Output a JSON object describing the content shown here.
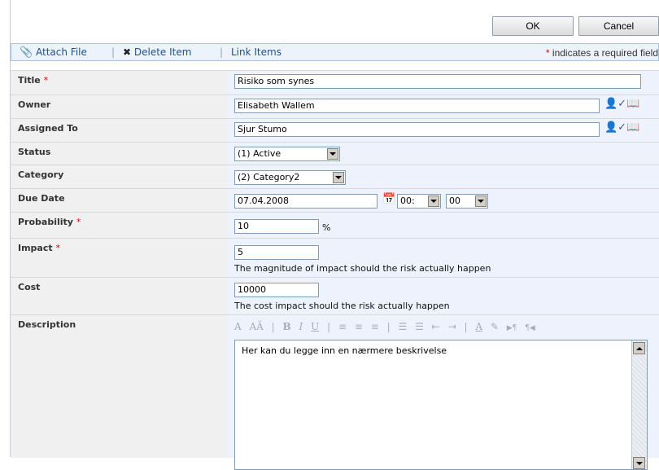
{
  "buttons": {
    "ok": "OK",
    "cancel": "Cancel"
  },
  "toolbar": {
    "attach": "Attach File",
    "delete": "Delete Item",
    "link": "Link Items",
    "separator": "|",
    "required_star": "*",
    "required_text": "indicates a required field"
  },
  "fields": {
    "title": {
      "label": "Title",
      "required": "*",
      "value": "Risiko som synes"
    },
    "owner": {
      "label": "Owner",
      "value": "Elisabeth Wallem"
    },
    "assigned": {
      "label": "Assigned To",
      "value": "Sjur Stumo"
    },
    "status": {
      "label": "Status",
      "value": "(1) Active"
    },
    "category": {
      "label": "Category",
      "value": "(2) Category2"
    },
    "due": {
      "label": "Due Date",
      "date": "07.04.2008",
      "hour": "00:",
      "minute": "00"
    },
    "probability": {
      "label": "Probability",
      "required": "*",
      "value": "10",
      "unit": "%"
    },
    "impact": {
      "label": "Impact",
      "required": "*",
      "value": "5",
      "help": "The magnitude of impact should the risk actually happen"
    },
    "cost": {
      "label": "Cost",
      "value": "10000",
      "help": "The cost impact should the risk actually happen"
    },
    "description": {
      "label": "Description",
      "value": "Her kan du legge inn en nærmere beskrivelse"
    }
  },
  "editor_toolbar": {
    "font_a": "A",
    "font_size": "AÄ",
    "bold": "B",
    "italic": "I",
    "underline": "U",
    "font_color": "A"
  },
  "icons": {
    "attach": "paperclip-icon",
    "delete": "delete-x-icon",
    "check_names": "check-names-icon",
    "browse": "address-book-icon",
    "calendar": "calendar-icon"
  },
  "colors": {
    "link": "#1f4f91",
    "required": "#e00000",
    "label_bg": "#f0f0f0",
    "value_bg": "#eef2fc"
  }
}
